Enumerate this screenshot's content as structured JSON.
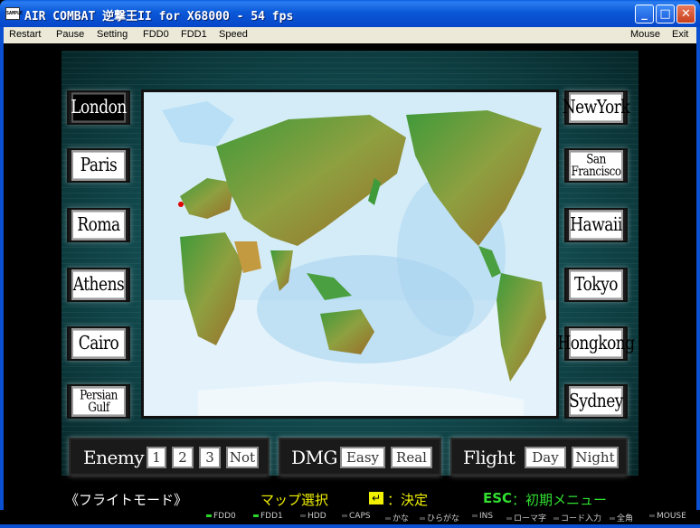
{
  "window": {
    "app_icon_text": "SAMPLE",
    "title": "AIR COMBAT 逆撃王II for X68000 - 54 fps",
    "minimize_glyph": "_",
    "maximize_glyph": "□",
    "close_glyph": "✕"
  },
  "menu": {
    "restart": "Restart",
    "pause": "Pause",
    "setting": "Setting",
    "fdd0": "FDD0",
    "fdd1": "FDD1",
    "speed": "Speed",
    "mouse": "Mouse",
    "exit": "Exit"
  },
  "cities_left": [
    "London",
    "Paris",
    "Roma",
    "Athens",
    "Cairo",
    "Persian Gulf"
  ],
  "cities_right": [
    "NewYork",
    "San Francisco",
    "Hawaii",
    "Tokyo",
    "Hongkong",
    "Sydney"
  ],
  "selected_city": "London",
  "options": {
    "enemy": {
      "label": "Enemy",
      "choices": [
        "1",
        "2",
        "3",
        "Not"
      ]
    },
    "dmg": {
      "label": "DMG",
      "choices": [
        "Easy",
        "Real"
      ]
    },
    "flight": {
      "label": "Flight",
      "choices": [
        "Day",
        "Night"
      ]
    }
  },
  "hints": {
    "mode": "《フライトモード》",
    "map_select": "マップ選択",
    "enter_key": "↵",
    "enter_label": "：決定",
    "esc_key": "ESC",
    "esc_label": "：初期メニュー"
  },
  "status": {
    "items": [
      "FDD0",
      "FDD1",
      "HDD",
      "CAPS",
      "かな",
      "ひらがな",
      "INS",
      "ローマ字",
      "コード入力",
      "全角",
      "MOUSE"
    ]
  },
  "colors": {
    "hint_yellow": "#f0f000",
    "hint_green": "#30e030",
    "hint_white": "#ffffff",
    "marker_red": "#e00000"
  }
}
